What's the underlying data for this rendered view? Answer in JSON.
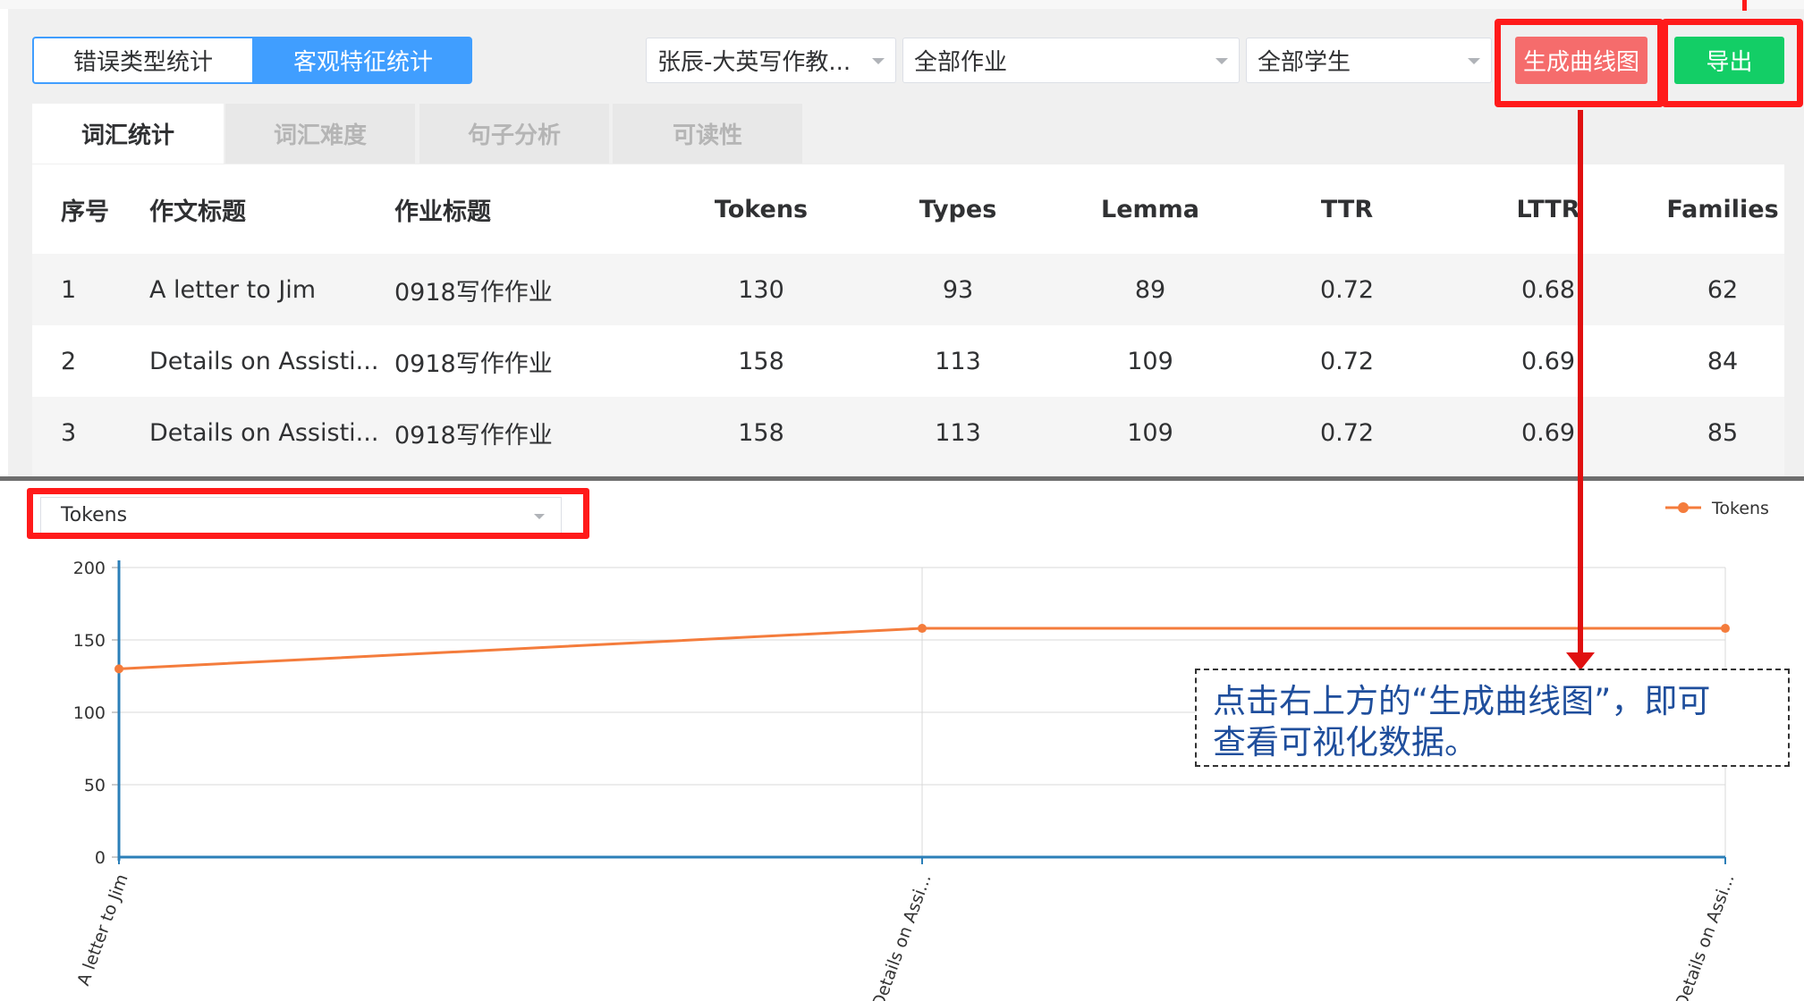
{
  "toolbar": {
    "segments": [
      "错误类型统计",
      "客观特征统计"
    ],
    "teacher_select": "张辰-大英写作教...",
    "homework_select": "全部作业",
    "student_select": "全部学生",
    "generate_curve_button": "生成曲线图",
    "export_button": "导出"
  },
  "tabs": [
    "词汇统计",
    "词汇难度",
    "句子分析",
    "可读性"
  ],
  "table": {
    "headers": [
      "序号",
      "作文标题",
      "作业标题",
      "Tokens",
      "Types",
      "Lemma",
      "TTR",
      "LTTR",
      "Families"
    ],
    "rows": [
      [
        "1",
        "A letter to Jim",
        "0918写作作业",
        "130",
        "93",
        "89",
        "0.72",
        "0.68",
        "62"
      ],
      [
        "2",
        "Details on Assisti...",
        "0918写作作业",
        "158",
        "113",
        "109",
        "0.72",
        "0.69",
        "84"
      ],
      [
        "3",
        "Details on Assisti...",
        "0918写作作业",
        "158",
        "113",
        "109",
        "0.72",
        "0.69",
        "85"
      ]
    ]
  },
  "chart_controls": {
    "metric_select": "Tokens"
  },
  "annotation": {
    "line1": "点击右上方的“生成曲线图”，即可",
    "line2": "查看可视化数据。"
  },
  "colors": {
    "primary": "#409eff",
    "danger": "#f56c6c",
    "success": "#13ce66",
    "highlight": "#ff1a1a",
    "series": "#f47c3c",
    "axis": "#2b7fb8"
  },
  "chart_data": {
    "type": "line",
    "categories": [
      "A letter to Jim",
      "Details on Assi...",
      "Details on Assi..."
    ],
    "series": [
      {
        "name": "Tokens",
        "values": [
          130,
          158,
          158
        ]
      }
    ],
    "ylim": [
      0,
      200
    ],
    "yticks": [
      0,
      50,
      100,
      150,
      200
    ],
    "legend_position": "top-right",
    "grid": true
  }
}
